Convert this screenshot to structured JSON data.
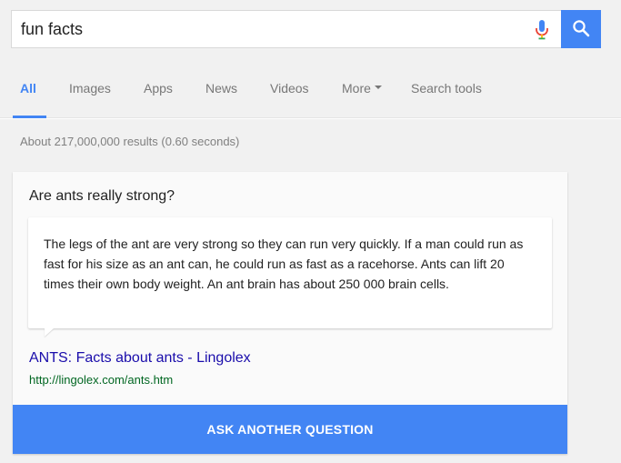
{
  "search": {
    "query": "fun facts"
  },
  "tabs": [
    {
      "label": "All",
      "active": true
    },
    {
      "label": "Images"
    },
    {
      "label": "Apps"
    },
    {
      "label": "News"
    },
    {
      "label": "Videos"
    },
    {
      "label": "More"
    },
    {
      "label": "Search tools"
    }
  ],
  "result_stats": "About 217,000,000 results (0.60 seconds)",
  "answer_card": {
    "question": "Are ants really strong?",
    "answer": "The legs of the ant are very strong so they can run very quickly. If a man could run as fast for his size as an ant can, he could run as fast as a racehorse. Ants can lift 20 times their own body weight. An ant brain has about 250 000 brain cells.",
    "source_title": "ANTS: Facts about ants - Lingolex",
    "source_url": "http://lingolex.com/ants.htm",
    "button_label": "ASK ANOTHER QUESTION"
  },
  "colors": {
    "accent": "#4285f4",
    "link": "#1a0dab",
    "url": "#006621"
  },
  "icons": [
    "microphone-icon",
    "search-icon",
    "caret-down-icon"
  ]
}
